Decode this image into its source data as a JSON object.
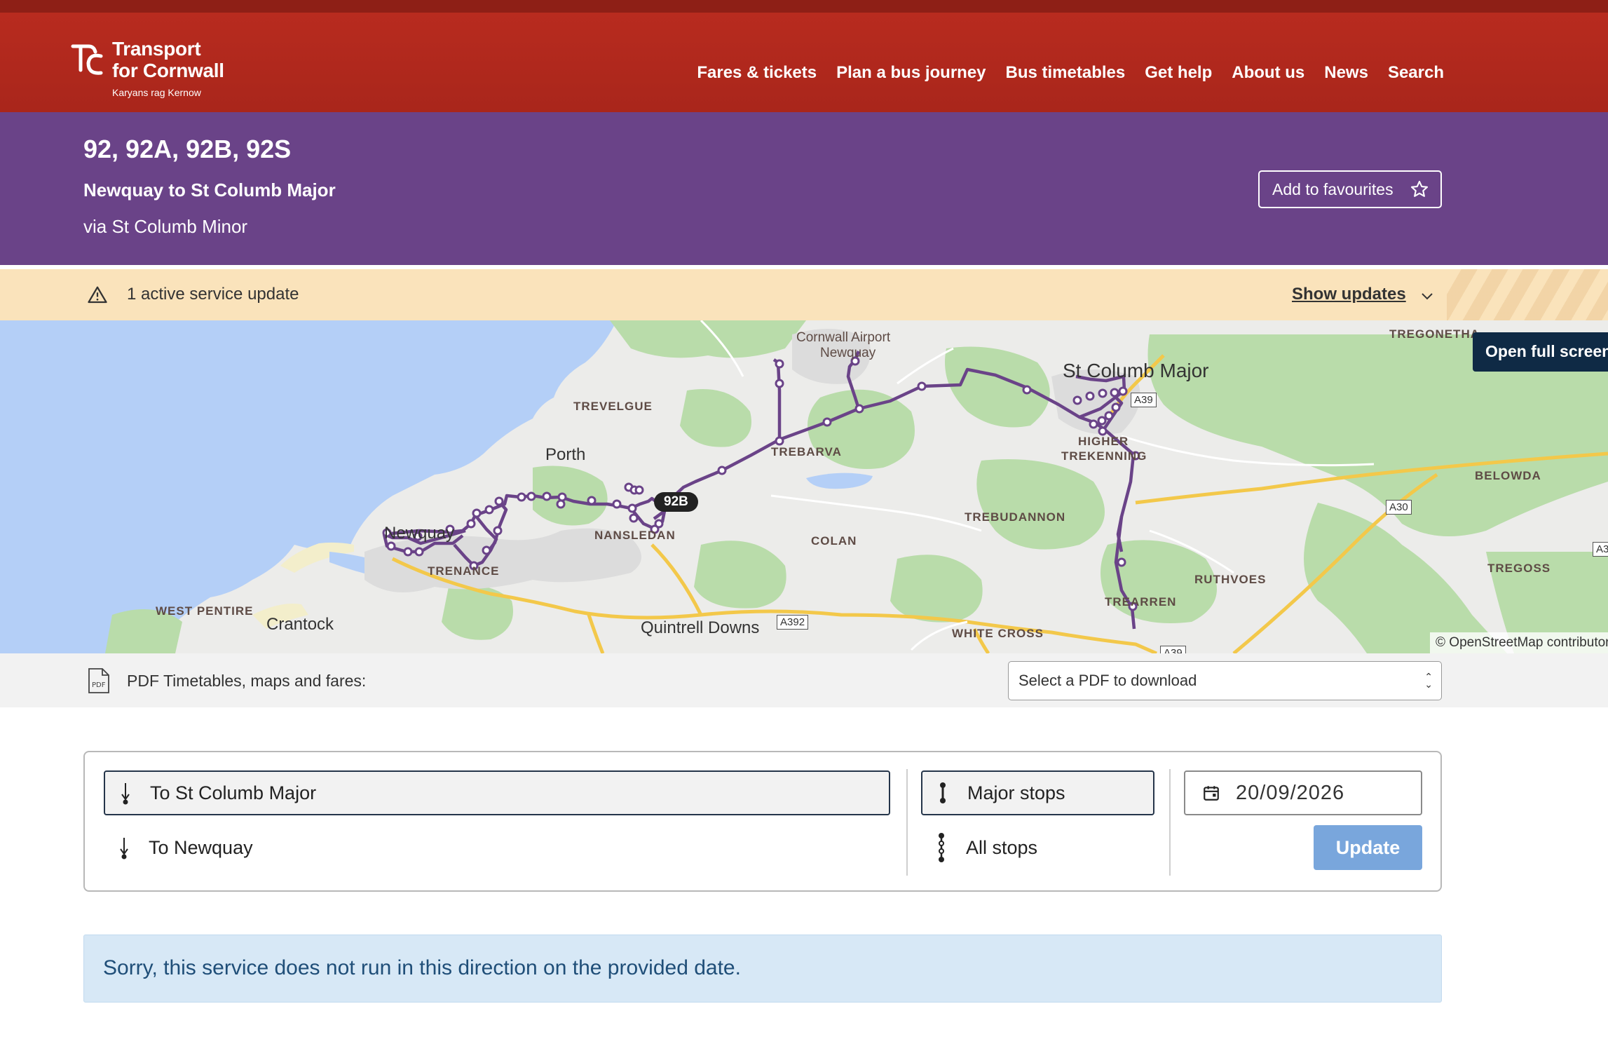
{
  "header": {
    "logo": {
      "title_line1": "Transport",
      "title_line2": "for Cornwall",
      "subtitle": "Karyans rag Kernow"
    },
    "nav": [
      "Fares & tickets",
      "Plan a bus journey",
      "Bus timetables",
      "Get help",
      "About us",
      "News",
      "Search"
    ]
  },
  "route": {
    "numbers": "92, 92A, 92B, 92S",
    "description": "Newquay to St Columb Major",
    "via": "via St Columb Minor",
    "favourites_label": "Add to favourites",
    "favourites_icon": "star-icon"
  },
  "alert": {
    "text": "1 active service update",
    "show_label": "Show updates",
    "icon": "warning-icon"
  },
  "map": {
    "fullscreen_label": "Open full screen",
    "attribution": "© OpenStreetMap contributors",
    "route_badge": "92B",
    "route_color": "#6a4388",
    "labels": {
      "airport_line1": "Cornwall Airport",
      "airport_line2": "Newquay",
      "st_columb_major": "St Columb Major",
      "tregonetha": "TREGONETHA",
      "trevelgue": "TREVELGUE",
      "porth": "Porth",
      "trebarva": "TREBARVA",
      "higher_line1": "HIGHER",
      "higher_line2": "TREKENNING",
      "belowda": "BELOWDA",
      "nansledan": "NANSLEDAN",
      "trebudannon": "TREBUDANNON",
      "colan": "COLAN",
      "newquay": "Newquay",
      "trenance": "TRENANCE",
      "tregoss": "TREGOSS",
      "ruthvoes": "RUTHVOES",
      "talskiddy": "TREARREN",
      "west_pentire": "WEST PENTIRE",
      "crantock": "Crantock",
      "quintrell_downs": "Quintrell Downs",
      "white_cross": "WHITE CROSS"
    },
    "roads": {
      "a39": "A39",
      "a30": "A30",
      "a392": "A392",
      "a39b": "A39",
      "a30b": "A3"
    }
  },
  "pdf": {
    "label": "PDF Timetables, maps and fares:",
    "select_placeholder": "Select a PDF to download"
  },
  "controls": {
    "direction_selected": "To St Columb Major",
    "direction_other": "To Newquay",
    "stops_selected": "Major stops",
    "stops_other": "All stops",
    "date_value": "20/09/2026",
    "update_label": "Update"
  },
  "notice": {
    "text": "Sorry, this service does not run in this direction on the provided date."
  }
}
